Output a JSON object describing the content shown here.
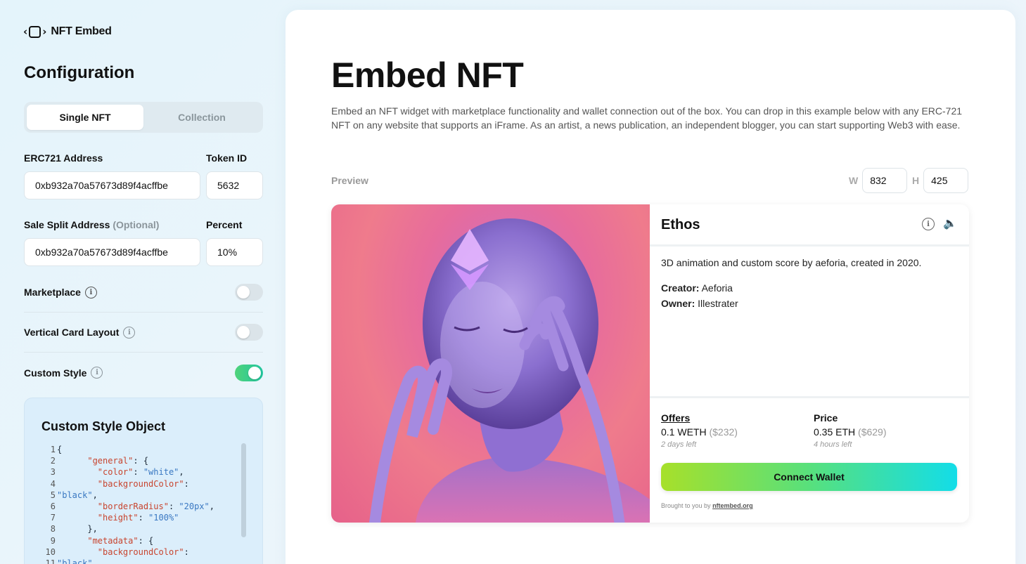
{
  "sidebar": {
    "logo_text": "NFT Embed",
    "title": "Configuration",
    "tabs": [
      "Single NFT",
      "Collection"
    ],
    "erc721_label": "ERC721 Address",
    "erc721_value": "0xb932a70a57673d89f4acffbe",
    "token_label": "Token ID",
    "token_value": "5632",
    "split_label": "Sale Split Address",
    "split_optional": "(Optional)",
    "split_value": "0xb932a70a57673d89f4acffbe",
    "percent_label": "Percent",
    "percent_value": "10%",
    "toggles": [
      {
        "label": "Marketplace",
        "on": false
      },
      {
        "label": "Vertical Card Layout",
        "on": false
      },
      {
        "label": "Custom Style",
        "on": true
      }
    ],
    "style_title": "Custom Style Object",
    "code_lines": [
      {
        "n": "1",
        "t": "{"
      },
      {
        "n": "2",
        "t": "      \"general\": {"
      },
      {
        "n": "3",
        "t": "        \"color\": \"white\","
      },
      {
        "n": "4",
        "t": "        \"backgroundColor\":"
      },
      {
        "n": "5",
        "t": "\"black\","
      },
      {
        "n": "6",
        "t": "        \"borderRadius\": \"20px\","
      },
      {
        "n": "7",
        "t": "        \"height\": \"100%\""
      },
      {
        "n": "8",
        "t": "      },"
      },
      {
        "n": "9",
        "t": "      \"metadata\": {"
      },
      {
        "n": "10",
        "t": "        \"backgroundColor\":"
      },
      {
        "n": "11",
        "t": "\"black\","
      }
    ]
  },
  "main": {
    "title": "Embed NFT",
    "intro": "Embed an NFT widget with marketplace functionality and wallet connection out of the box. You can drop in this example below with any ERC-721 NFT on any website that supports an iFrame. As an artist, a news publication, an independent blogger, you can start supporting Web3 with ease.",
    "preview_label": "Preview",
    "w_label": "W",
    "w_value": "832",
    "h_label": "H",
    "h_value": "425"
  },
  "card": {
    "title": "Ethos",
    "description": "3D animation and custom score by aeforia, created in 2020.",
    "creator_label": "Creator:",
    "creator": "Aeforia",
    "owner_label": "Owner:",
    "owner": "Illestrater",
    "offers_label": "Offers",
    "offers_value": "0.1 WETH",
    "offers_usd": "($232)",
    "offers_time": "2 days left",
    "price_label": "Price",
    "price_value": "0.35 ETH",
    "price_usd": "($629)",
    "price_time": "4 hours left",
    "connect_label": "Connect Wallet",
    "brought_text": "Brought to you by",
    "brought_link": "nftembed.org"
  },
  "colors": {
    "accent_gradient_start": "#a7e02a",
    "accent_gradient_end": "#13dde8",
    "toggle_on": "#4fd37a"
  }
}
